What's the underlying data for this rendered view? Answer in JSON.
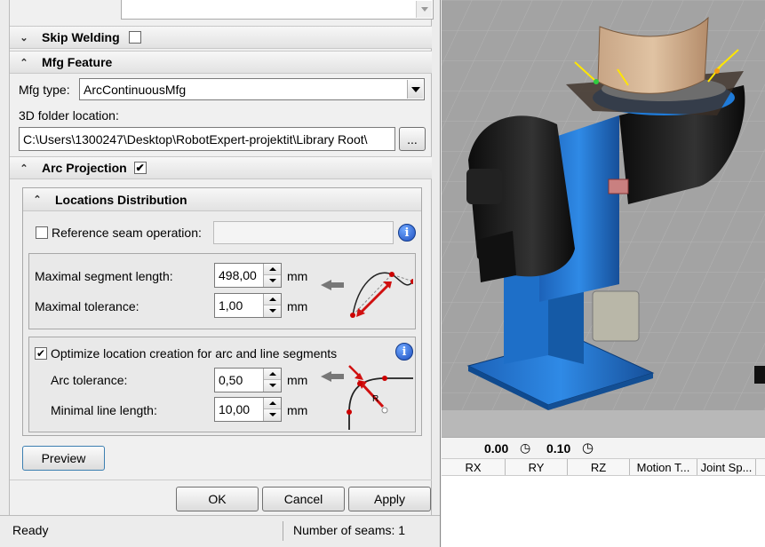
{
  "skip_welding": {
    "title": "Skip Welding",
    "checked": false
  },
  "mfg_feature": {
    "title": "Mfg Feature",
    "mfg_type_label": "Mfg type:",
    "mfg_type_value": "ArcContinuousMfg",
    "folder_label": "3D folder location:",
    "folder_value": "C:\\Users\\1300247\\Desktop\\RobotExpert-projektit\\Library Root\\",
    "browse_label": "..."
  },
  "arc_projection": {
    "title": "Arc Projection",
    "checked": true,
    "checkmark": "✔",
    "locations_distribution": {
      "title": "Locations Distribution",
      "reference_seam_label": "Reference seam operation:",
      "reference_seam_value": "",
      "max_segment_label": "Maximal segment length:",
      "max_segment_value": "498,00",
      "max_tolerance_label": "Maximal tolerance:",
      "max_tolerance_value": "1,00",
      "unit": "mm",
      "optimize_label": "Optimize location creation for arc and line segments",
      "arc_tolerance_label": "Arc tolerance:",
      "arc_tolerance_value": "0,50",
      "min_line_label": "Minimal line length:",
      "min_line_value": "10,00",
      "diagram_r_label": "R"
    }
  },
  "buttons": {
    "preview": "Preview",
    "ok": "OK",
    "cancel": "Cancel",
    "apply": "Apply"
  },
  "status": {
    "left": "Ready",
    "right": "Number of seams:  1"
  },
  "viewport_toolbar": {
    "value1": "0.00",
    "value2": "0.10"
  },
  "grid_headers": [
    "RX",
    "RY",
    "RZ",
    "Motion T...",
    "Joint Sp..."
  ],
  "colors": {
    "robot_blue": "#1f7bd9",
    "robot_black": "#1a1a1a",
    "floor": "#9c9c9c",
    "accent_red": "#d01010"
  }
}
